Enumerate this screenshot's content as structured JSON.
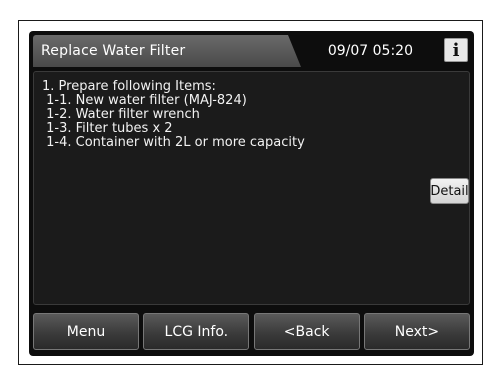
{
  "header": {
    "title": "Replace Water Filter",
    "datetime": "09/07 05:20",
    "info_label": "i"
  },
  "content": {
    "lines": [
      "1. Prepare following Items:",
      " 1-1. New water filter (MAJ-824)",
      " 1-2. Water filter wrench",
      " 1-3. Filter tubes x 2",
      " 1-4. Container with 2L or more capacity"
    ],
    "detail_label": "Detail"
  },
  "nav": {
    "buttons": [
      "Menu",
      "LCG Info.",
      "<Back",
      "Next>"
    ]
  }
}
